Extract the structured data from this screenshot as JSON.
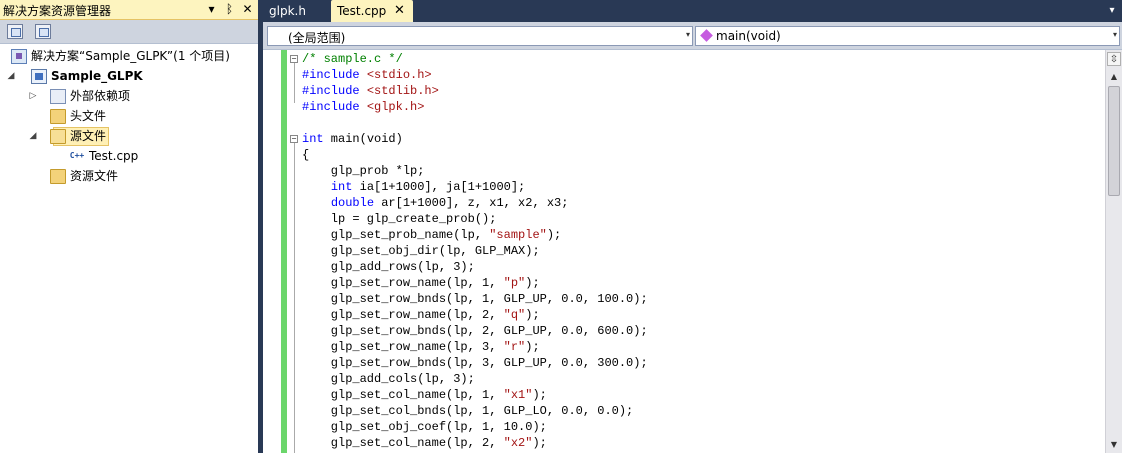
{
  "solution_explorer": {
    "title": "解决方案资源管理器",
    "btn_dropdown": "▾",
    "btn_pin": "ᛒ",
    "btn_close": "✕",
    "tree": {
      "solution": "解决方案“Sample_GLPK”(1 个项目)",
      "project": "Sample_GLPK",
      "ext_deps": "外部依赖项",
      "headers": "头文件",
      "sources": "源文件",
      "source_file": "Test.cpp",
      "resources": "资源文件"
    },
    "twisty_collapsed": "▷",
    "twisty_expanded": "◢",
    "cpp_icon_text": "C++"
  },
  "tabs": [
    {
      "label": "glpk.h",
      "active": false
    },
    {
      "label": "Test.cpp",
      "active": true,
      "close": "✕"
    }
  ],
  "tab_dropdown": "▾",
  "navbar": {
    "scope": "(全局范围)",
    "member": "main(void)",
    "arrow": "▾"
  },
  "scrollbar": {
    "split": "⇳",
    "up": "▲",
    "down": "▼"
  },
  "code": {
    "lines": [
      "/* sample.c */",
      "#include <stdio.h>",
      "#include <stdlib.h>",
      "#include <glpk.h>",
      "",
      "int main(void)",
      "{",
      "    glp_prob *lp;",
      "    int ia[1+1000], ja[1+1000];",
      "    double ar[1+1000], z, x1, x2, x3;",
      "    lp = glp_create_prob();",
      "    glp_set_prob_name(lp, \"sample\");",
      "    glp_set_obj_dir(lp, GLP_MAX);",
      "    glp_add_rows(lp, 3);",
      "    glp_set_row_name(lp, 1, \"p\");",
      "    glp_set_row_bnds(lp, 1, GLP_UP, 0.0, 100.0);",
      "    glp_set_row_name(lp, 2, \"q\");",
      "    glp_set_row_bnds(lp, 2, GLP_UP, 0.0, 600.0);",
      "    glp_set_row_name(lp, 3, \"r\");",
      "    glp_set_row_bnds(lp, 3, GLP_UP, 0.0, 300.0);",
      "    glp_add_cols(lp, 3);",
      "    glp_set_col_name(lp, 1, \"x1\");",
      "    glp_set_col_bnds(lp, 1, GLP_LO, 0.0, 0.0);",
      "    glp_set_obj_coef(lp, 1, 10.0);",
      "    glp_set_col_name(lp, 2, \"x2\");"
    ]
  },
  "colors": {
    "keyword": "#0000ff",
    "comment": "#008000",
    "string": "#a31515",
    "change_bar": "#6bd66b",
    "active_tab": "#fdf4bf",
    "chrome": "#293955"
  }
}
